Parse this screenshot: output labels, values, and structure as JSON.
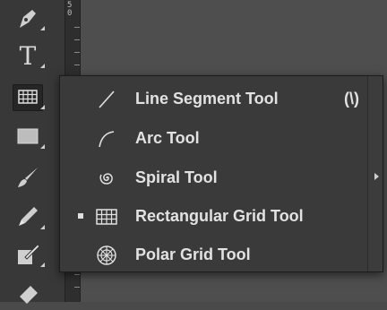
{
  "ruler": {
    "label": "5\n0"
  },
  "toolbar": {
    "tools": [
      {
        "name": "pen-tool",
        "icon": "pen-icon",
        "has_flyout": true
      },
      {
        "name": "type-tool",
        "icon": "type-icon",
        "glyph": "T",
        "has_flyout": true
      },
      {
        "name": "rectangular-grid-tool",
        "icon": "rectangular-grid-icon",
        "has_flyout": true,
        "active": true
      },
      {
        "name": "rectangle-tool",
        "icon": "rectangle-icon",
        "has_flyout": true
      },
      {
        "name": "paintbrush-tool",
        "icon": "paintbrush-icon",
        "has_flyout": false
      },
      {
        "name": "pencil-tool",
        "icon": "pencil-icon",
        "has_flyout": true
      },
      {
        "name": "shaper-tool",
        "icon": "shaper-icon",
        "has_flyout": true
      },
      {
        "name": "eraser-tool",
        "icon": "eraser-icon",
        "has_flyout": false
      }
    ]
  },
  "flyout": {
    "items": [
      {
        "label": "Line Segment Tool",
        "shortcut": "(\\)",
        "icon": "line-segment-icon",
        "selected": false
      },
      {
        "label": "Arc Tool",
        "shortcut": "",
        "icon": "arc-icon",
        "selected": false
      },
      {
        "label": "Spiral Tool",
        "shortcut": "",
        "icon": "spiral-icon",
        "selected": false
      },
      {
        "label": "Rectangular Grid Tool",
        "shortcut": "",
        "icon": "rectangular-grid-icon",
        "selected": true
      },
      {
        "label": "Polar Grid Tool",
        "shortcut": "",
        "icon": "polar-grid-icon",
        "selected": false
      }
    ],
    "tearoff_icon": "tearoff-arrow-icon"
  },
  "colors": {
    "panel": "#383838",
    "menu": "#3a3a3a",
    "text": "#e2e2e2",
    "canvas": "#4e4e4e"
  }
}
